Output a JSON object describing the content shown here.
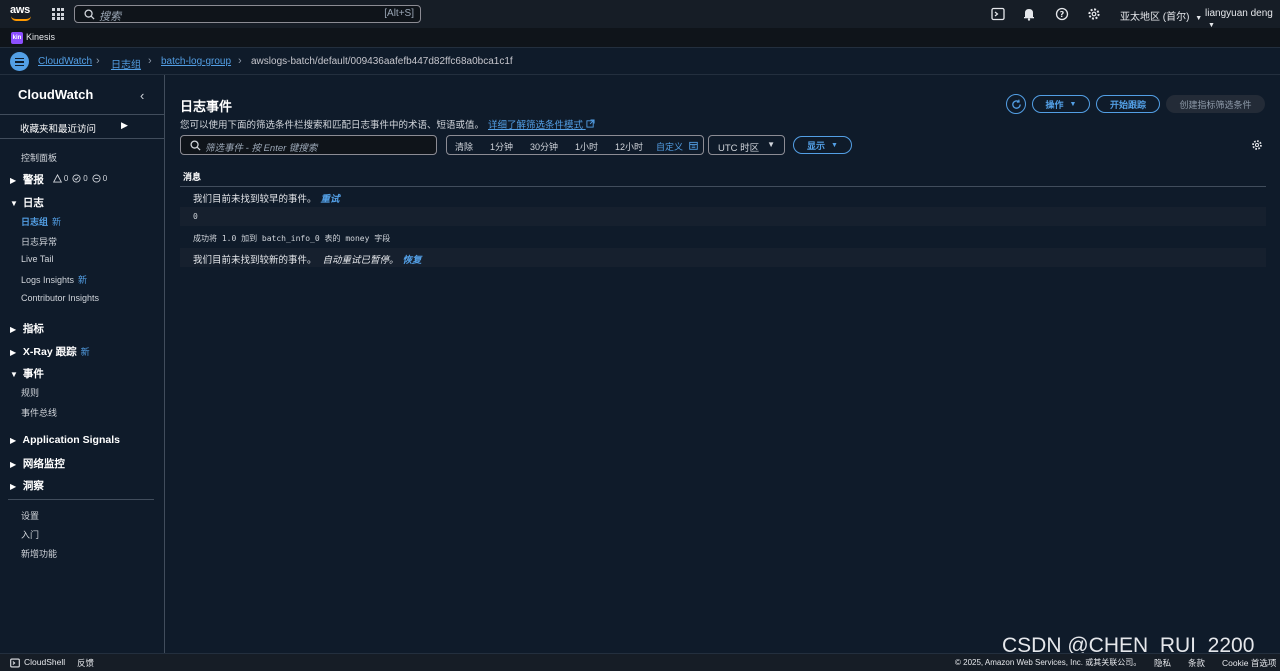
{
  "topbar": {
    "logo_text": "aws",
    "search_placeholder": "搜索",
    "search_shortcut": "[Alt+S]",
    "region": "亚太地区 (首尔)",
    "user": "liangyuan deng"
  },
  "service_bar": {
    "badge": "kin",
    "label": "Kinesis"
  },
  "breadcrumb": [
    {
      "label": "CloudWatch"
    },
    {
      "label": "日志组"
    },
    {
      "label": "batch-log-group"
    },
    {
      "label": "awslogs-batch/default/009436aafefb447d82ffc68a0bca1c1f"
    }
  ],
  "sidebar": {
    "title": "CloudWatch",
    "favorites": "收藏夹和最近访问",
    "dashboard": "控制面板",
    "alarms": {
      "label": "警报",
      "counts": [
        "0",
        "0",
        "0"
      ]
    },
    "logs": {
      "label": "日志",
      "items": [
        "日志组",
        "日志异常",
        "Live Tail",
        "Logs Insights",
        "Contributor Insights"
      ]
    },
    "new_badge": "新",
    "metrics": "指标",
    "xray": "X-Ray 跟踪",
    "events": {
      "label": "事件",
      "items": [
        "规则",
        "事件总线"
      ]
    },
    "application_signals": "Application Signals",
    "network_monitoring": "网络监控",
    "insights": "洞察",
    "bottom_items": [
      "设置",
      "入门",
      "新增功能"
    ]
  },
  "main": {
    "title": "日志事件",
    "description": "您可以使用下面的筛选条件栏搜索和匹配日志事件中的术语、短语或值。",
    "learn_more": "详细了解筛选条件模式",
    "actions_button": "操作",
    "start_tailing_button": "开始跟踪",
    "create_metric_filter_button": "创建指标筛选条件",
    "filter_placeholder": "筛选事件 - 按 Enter 键搜索",
    "time_options": [
      "清除",
      "1分钟",
      "30分钟",
      "1小时",
      "12小时",
      "自定义"
    ],
    "timezone": "UTC 时区",
    "display_button": "显示",
    "column_header": "消息",
    "rows": {
      "no_older": "我们目前未找到较早的事件。",
      "retry": "重试",
      "zero": "0",
      "added": "成功将 1.0 加到 batch_info_0 表的 money 字段",
      "no_newer": "我们目前未找到较新的事件。",
      "auto_retry_paused": "自动重试已暂停。",
      "resume": "恢复"
    }
  },
  "footer": {
    "cloudshell": "CloudShell",
    "feedback": "反馈",
    "copyright": "© 2025, Amazon Web Services, Inc. 或其关联公司。",
    "privacy": "隐私",
    "terms": "条款",
    "cookie": "Cookie 首选项"
  },
  "watermark": "CSDN @CHEN_RUI_2200",
  "colors": {
    "accent": "#539fe5",
    "background": "#0f1b2a",
    "topbar": "#161d26"
  }
}
